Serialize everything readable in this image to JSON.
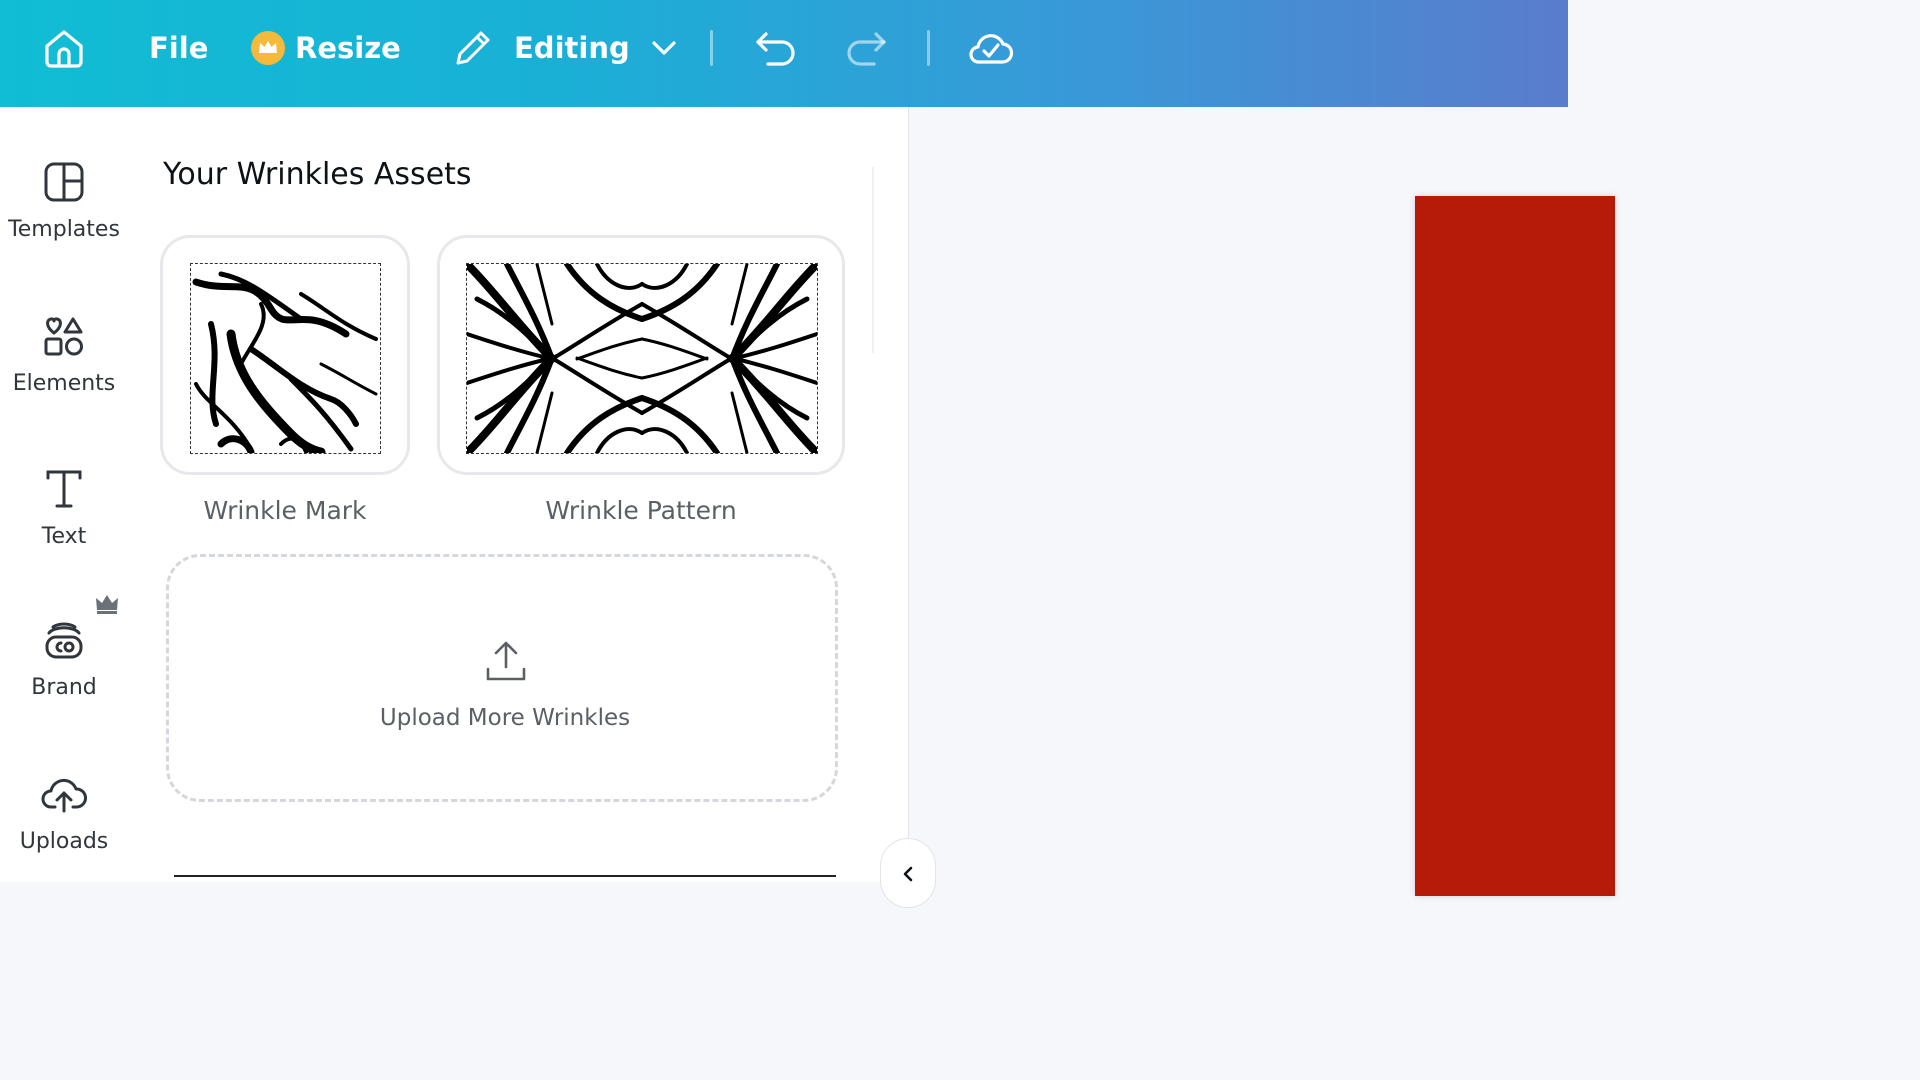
{
  "topbar": {
    "file_label": "File",
    "resize_label": "Resize",
    "editing_label": "Editing",
    "colors": {
      "gradient_start": "#10bdd4",
      "gradient_end": "#5a7ccc",
      "crown": "#f5b93c"
    },
    "icons": [
      "home-icon",
      "crown-icon",
      "pencil-icon",
      "chevron-down-icon",
      "undo-icon",
      "redo-icon",
      "cloud-check-icon"
    ]
  },
  "sidebar": {
    "items": [
      {
        "label": "Templates",
        "icon": "templates-icon"
      },
      {
        "label": "Elements",
        "icon": "elements-icon"
      },
      {
        "label": "Text",
        "icon": "text-icon"
      },
      {
        "label": "Brand",
        "icon": "brand-icon"
      },
      {
        "label": "Uploads",
        "icon": "uploads-icon"
      }
    ]
  },
  "panel": {
    "title": "Your Wrinkles Assets",
    "assets": [
      {
        "label": "Wrinkle Mark"
      },
      {
        "label": "Wrinkle Pattern"
      }
    ],
    "upload_label": "Upload More Wrinkles"
  },
  "canvas": {
    "page_color": "#b51b08"
  }
}
